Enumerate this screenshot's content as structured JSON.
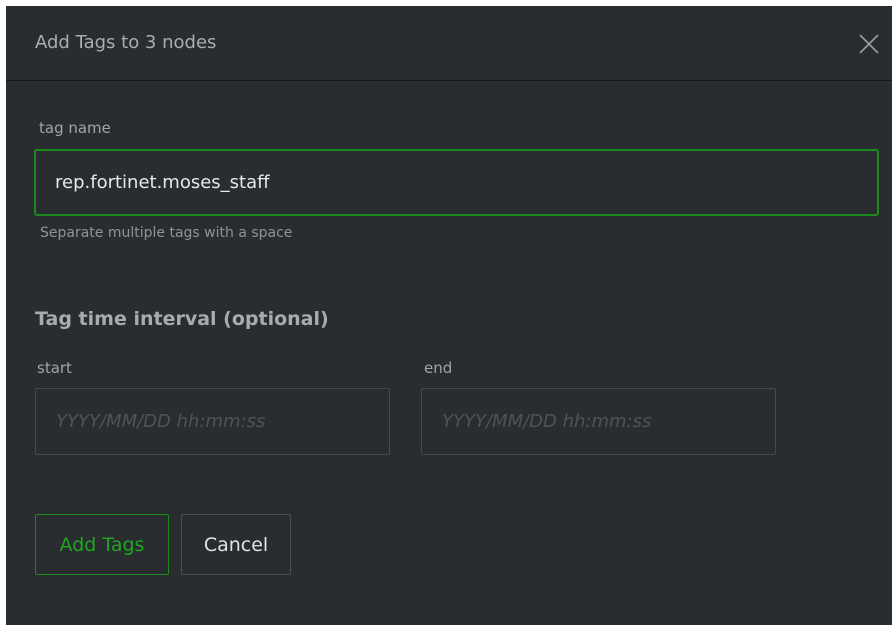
{
  "dialog": {
    "title": "Add Tags to 3 nodes",
    "close_icon": "close-icon"
  },
  "tag_name": {
    "label": "tag name",
    "value": "rep.fortinet.moses_staff",
    "hint": "Separate multiple tags with a space"
  },
  "interval": {
    "section_title": "Tag time interval (optional)",
    "start_label": "start",
    "start_placeholder": "YYYY/MM/DD hh:mm:ss",
    "end_label": "end",
    "end_placeholder": "YYYY/MM/DD hh:mm:ss"
  },
  "actions": {
    "add_label": "Add Tags",
    "cancel_label": "Cancel"
  },
  "colors": {
    "accent": "#1c8a1c",
    "background": "#2a2d30"
  }
}
